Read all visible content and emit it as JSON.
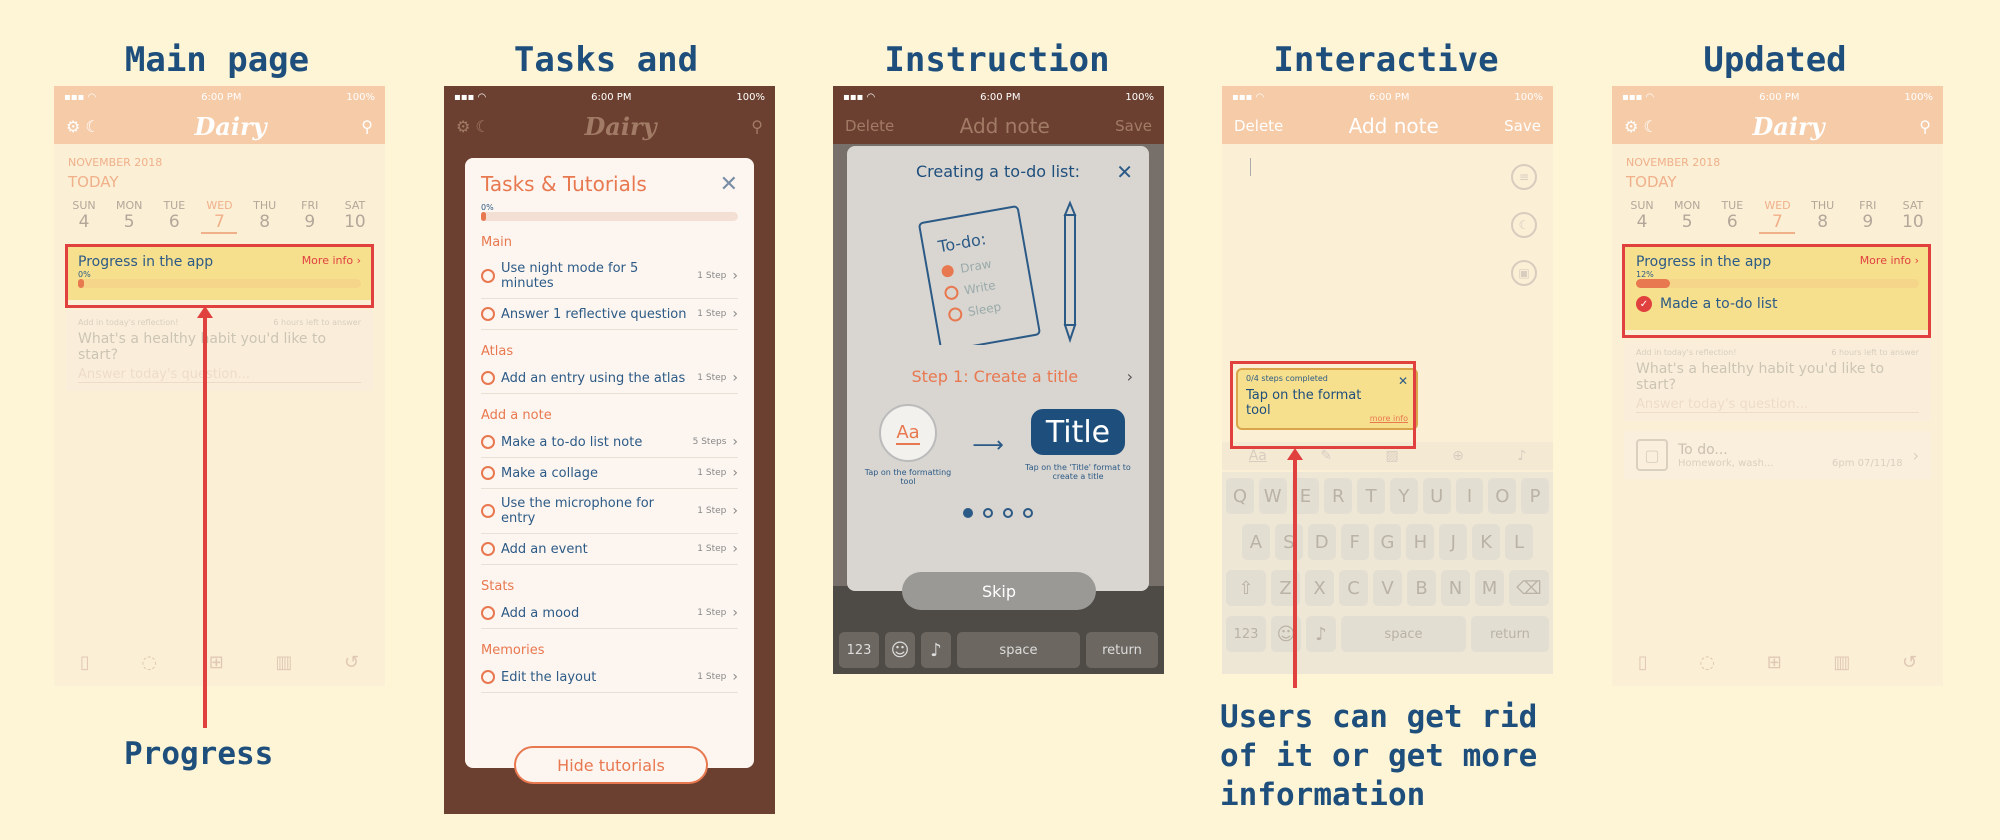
{
  "titles": [
    "Main page",
    "Tasks and",
    "Instruction",
    "Interactive",
    "Updated"
  ],
  "captions": {
    "progress": "Progress",
    "interactive_line1": "Users can get rid",
    "interactive_line2": "of it or get more",
    "interactive_line3": "information"
  },
  "status_time": "6:00 PM",
  "status_battery": "100%",
  "app_logo": "Dairy",
  "month": "NOVEMBER 2018",
  "today": "TODAY",
  "weekdays": [
    {
      "d": "SUN",
      "n": "4"
    },
    {
      "d": "MON",
      "n": "5"
    },
    {
      "d": "TUE",
      "n": "6"
    },
    {
      "d": "WED",
      "n": "7"
    },
    {
      "d": "THU",
      "n": "8"
    },
    {
      "d": "FRI",
      "n": "9"
    },
    {
      "d": "SAT",
      "n": "10"
    }
  ],
  "progress_card": {
    "title": "Progress in the app",
    "more": "More info",
    "pct_main": "0%",
    "pct_main_value": 0.02,
    "pct_updated": "12%",
    "pct_updated_value": 0.12,
    "done_item": "Made a to-do list"
  },
  "reflection": {
    "meta": "Add in today's reflection!",
    "time_left": "6 hours left to answer",
    "question": "What's a healthy habit you'd like to start?",
    "answer_placeholder": "Answer today's question..."
  },
  "todo_card": {
    "title": "To do...",
    "sub": "Homework, wash...",
    "time": "6pm 07/11/18"
  },
  "tutorials": {
    "title": "Tasks & Tutorials",
    "pct": "0%",
    "pct_value": 0.02,
    "sections": [
      {
        "name": "Main",
        "items": [
          {
            "label": "Use night mode for 5 minutes",
            "steps": "1 Step"
          },
          {
            "label": "Answer 1 reflective question",
            "steps": "1 Step"
          }
        ]
      },
      {
        "name": "Atlas",
        "items": [
          {
            "label": "Add an entry using the atlas",
            "steps": "1 Step"
          }
        ]
      },
      {
        "name": "Add a note",
        "items": [
          {
            "label": "Make a to-do list note",
            "steps": "5 Steps"
          },
          {
            "label": "Make a collage",
            "steps": "1 Step"
          },
          {
            "label": "Use the microphone for entry",
            "steps": "1 Step"
          },
          {
            "label": "Add an event",
            "steps": "1 Step"
          }
        ]
      },
      {
        "name": "Stats",
        "items": [
          {
            "label": "Add a mood",
            "steps": "1 Step"
          }
        ]
      },
      {
        "name": "Memories",
        "items": [
          {
            "label": "Edit the layout",
            "steps": "1 Step"
          }
        ]
      }
    ],
    "hide_button": "Hide tutorials"
  },
  "add_note": {
    "delete": "Delete",
    "title": "Add note",
    "save": "Save"
  },
  "instruction": {
    "title": "Creating a to-do list:",
    "todo_heading": "To-do:",
    "todo_items": [
      "Draw",
      "Write",
      "Sleep"
    ],
    "step": "Step 1: Create a title",
    "tool_glyph": "Aa",
    "tool_caption": "Tap on the formatting tool",
    "title_glyph": "Title",
    "title_caption": "Tap on the 'Title' format to create a title",
    "skip": "Skip"
  },
  "tooltip": {
    "steps": "0/4 steps completed",
    "text": "Tap on the format tool",
    "more": "more info"
  },
  "keyboard": {
    "row1": [
      "Q",
      "W",
      "E",
      "R",
      "T",
      "Y",
      "U",
      "I",
      "O",
      "P"
    ],
    "row2": [
      "A",
      "S",
      "D",
      "F",
      "G",
      "H",
      "J",
      "K",
      "L"
    ],
    "row3": [
      "Z",
      "X",
      "C",
      "V",
      "B",
      "N",
      "M"
    ],
    "num": "123",
    "space": "space",
    "ret": "return"
  },
  "colors": {
    "accent": "#e8784f",
    "navy": "#1e4e7c",
    "highlight": "#e0413f",
    "yellow_card": "#f6e08e"
  }
}
